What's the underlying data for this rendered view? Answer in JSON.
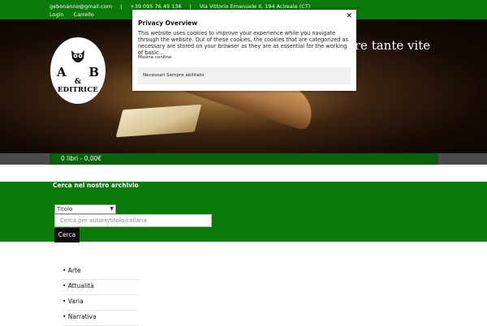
{
  "topbar": {
    "email": "gebonanno@gmail.com",
    "phone": "+39 095 76 49 136",
    "address": "Via Vittorio Emanuele II, 194 Acireale (CT)",
    "login": "Login",
    "cart": "Carrello"
  },
  "hero": {
    "tagline": "ere tante vite"
  },
  "logo": {
    "left_letter": "A",
    "right_letter": "B",
    "ampersand": "&",
    "name": "EDITRICE"
  },
  "cartbar": {
    "summary": "0 libri - 0,00€"
  },
  "search": {
    "title": "Cerca nel nostro archivio",
    "select_value": "Titolo",
    "input_placeholder": "Cerca per autore/titolo/collana",
    "button": "Cerca"
  },
  "categories": [
    "• Arte",
    "• Attualità",
    "• Varia",
    "• Narrativa"
  ],
  "modal": {
    "title": "Privacy Overview",
    "body": "This website uses cookies to improve your experience while you navigate through the website. Out of these cookies, the cookies that are categorized as necessary are stored on your browser as they are as essential for the working of basic...",
    "more": "Mostra confine",
    "necessary_label": "Necessari",
    "necessary_state": "Sempre abilitato",
    "close_icon": "close-icon"
  },
  "colors": {
    "green": "#0a7a0a",
    "dark_green": "#0a5f0a",
    "gray_bar": "#4b4b4b"
  }
}
